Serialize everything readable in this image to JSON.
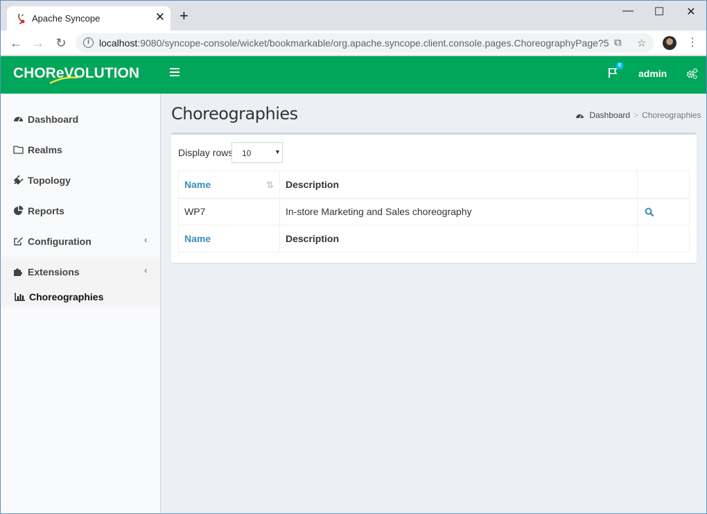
{
  "browser": {
    "tab_title": "Apache Syncope",
    "url_host": "localhost",
    "url_rest": ":9080/syncope-console/wicket/bookmarkable/org.apache.syncope.client.console.pages.ChoreographyPage?5"
  },
  "header": {
    "logo_text": "CHOReVOLUTION",
    "notification_count": "0",
    "user": "admin"
  },
  "sidebar": {
    "items": [
      {
        "label": "Dashboard",
        "icon": "dashboard-icon"
      },
      {
        "label": "Realms",
        "icon": "folder-icon"
      },
      {
        "label": "Topology",
        "icon": "plug-icon"
      },
      {
        "label": "Reports",
        "icon": "pie-chart-icon"
      },
      {
        "label": "Configuration",
        "icon": "edit-icon"
      },
      {
        "label": "Extensions",
        "icon": "puzzle-icon"
      }
    ],
    "sub_item": {
      "label": "Choreographies",
      "icon": "bar-chart-icon"
    }
  },
  "page": {
    "title": "Choreographies",
    "breadcrumb": {
      "home": "Dashboard",
      "current": "Choreographies"
    }
  },
  "table": {
    "display_rows_label": "Display rows",
    "display_rows_value": "10",
    "headers": {
      "name": "Name",
      "description": "Description"
    },
    "rows": [
      {
        "name": "WP7",
        "description": "In-store Marketing and Sales choreography"
      }
    ]
  },
  "colors": {
    "topbar": "#00a65a",
    "link": "#3c8dbc"
  }
}
